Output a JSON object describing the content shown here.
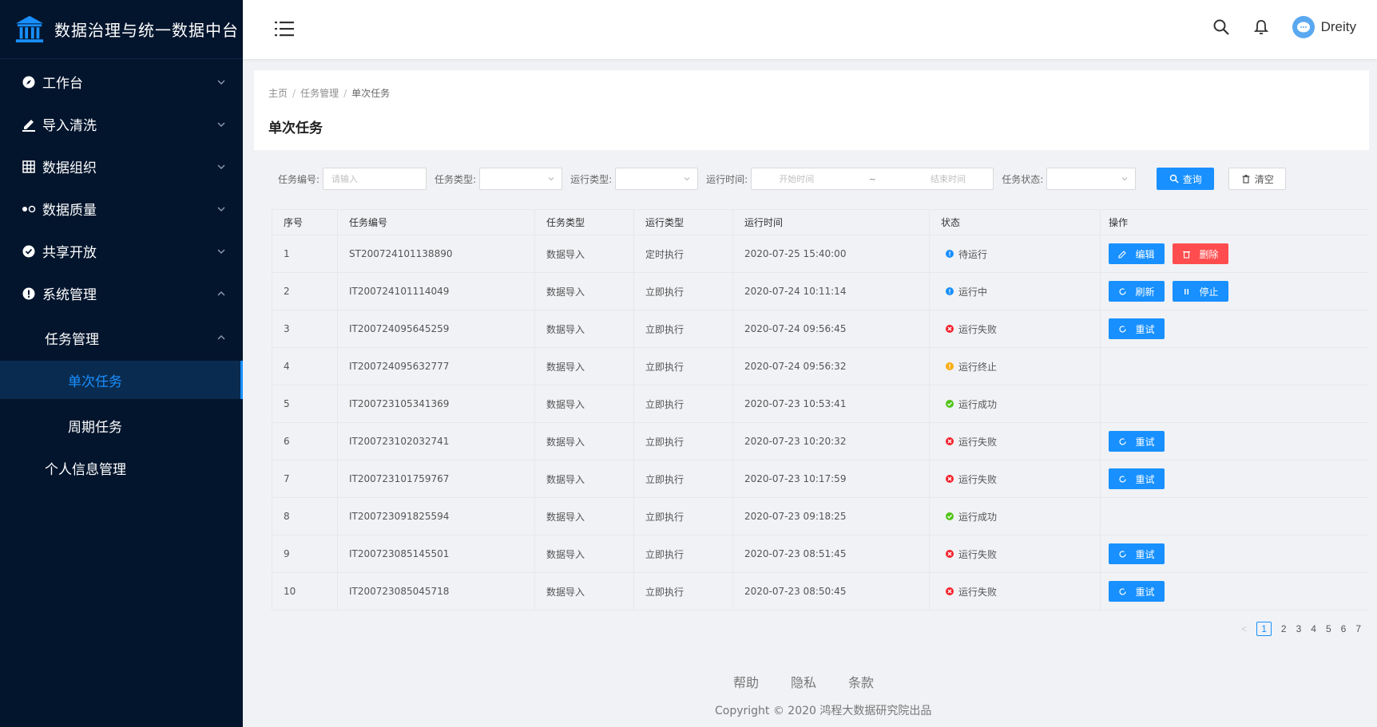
{
  "app": {
    "title": "数据治理与统一数据中台"
  },
  "sidebar": {
    "items": [
      {
        "label": "工作台",
        "icon": "compass-icon"
      },
      {
        "label": "导入清洗",
        "icon": "edit-icon"
      },
      {
        "label": "数据组织",
        "icon": "grid-icon"
      },
      {
        "label": "数据质量",
        "icon": "toggle-icon"
      },
      {
        "label": "共享开放",
        "icon": "check-circle-icon"
      },
      {
        "label": "系统管理",
        "icon": "alert-circle-icon"
      }
    ],
    "sub": {
      "label": "任务管理"
    },
    "subsub": [
      {
        "label": "单次任务"
      },
      {
        "label": "周期任务"
      }
    ],
    "personal": {
      "label": "个人信息管理"
    }
  },
  "header": {
    "username": "Dreity"
  },
  "breadcrumb": {
    "home": "主页",
    "parent": "任务管理",
    "current": "单次任务"
  },
  "page": {
    "title": "单次任务"
  },
  "filter": {
    "task_no_label": "任务编号:",
    "task_no_placeholder": "请输入",
    "task_type_label": "任务类型:",
    "run_type_label": "运行类型:",
    "run_time_label": "运行时间:",
    "start_placeholder": "开始时间",
    "range_sep": "~",
    "end_placeholder": "结束时间",
    "status_label": "任务状态:",
    "query_label": "查询",
    "clear_label": "清空"
  },
  "table": {
    "headers": [
      "序号",
      "任务编号",
      "任务类型",
      "运行类型",
      "运行时间",
      "状态",
      "操作"
    ],
    "rows": [
      {
        "no": "1",
        "id": "ST200724101138890",
        "type": "数据导入",
        "run": "定时执行",
        "time": "2020-07-25 15:40:00",
        "status": "待运行",
        "color": "#1890ff",
        "actions": [
          "编辑",
          "删除"
        ]
      },
      {
        "no": "2",
        "id": "IT200724101114049",
        "type": "数据导入",
        "run": "立即执行",
        "time": "2020-07-24 10:11:14",
        "status": "运行中",
        "color": "#1890ff",
        "actions": [
          "刷新",
          "停止"
        ]
      },
      {
        "no": "3",
        "id": "IT200724095645259",
        "type": "数据导入",
        "run": "立即执行",
        "time": "2020-07-24 09:56:45",
        "status": "运行失败",
        "color": "#f5222d",
        "actions": [
          "重试"
        ]
      },
      {
        "no": "4",
        "id": "IT200724095632777",
        "type": "数据导入",
        "run": "立即执行",
        "time": "2020-07-24 09:56:32",
        "status": "运行终止",
        "color": "#faad14",
        "actions": []
      },
      {
        "no": "5",
        "id": "IT200723105341369",
        "type": "数据导入",
        "run": "立即执行",
        "time": "2020-07-23 10:53:41",
        "status": "运行成功",
        "color": "#52c41a",
        "actions": []
      },
      {
        "no": "6",
        "id": "IT200723102032741",
        "type": "数据导入",
        "run": "立即执行",
        "time": "2020-07-23 10:20:32",
        "status": "运行失败",
        "color": "#f5222d",
        "actions": [
          "重试"
        ]
      },
      {
        "no": "7",
        "id": "IT200723101759767",
        "type": "数据导入",
        "run": "立即执行",
        "time": "2020-07-23 10:17:59",
        "status": "运行失败",
        "color": "#f5222d",
        "actions": [
          "重试"
        ]
      },
      {
        "no": "8",
        "id": "IT200723091825594",
        "type": "数据导入",
        "run": "立即执行",
        "time": "2020-07-23 09:18:25",
        "status": "运行成功",
        "color": "#52c41a",
        "actions": []
      },
      {
        "no": "9",
        "id": "IT200723085145501",
        "type": "数据导入",
        "run": "立即执行",
        "time": "2020-07-23 08:51:45",
        "status": "运行失败",
        "color": "#f5222d",
        "actions": [
          "重试"
        ]
      },
      {
        "no": "10",
        "id": "IT200723085045718",
        "type": "数据导入",
        "run": "立即执行",
        "time": "2020-07-23 08:50:45",
        "status": "运行失败",
        "color": "#f5222d",
        "actions": [
          "重试"
        ]
      }
    ]
  },
  "pagination": {
    "prev": "<",
    "pages": [
      "1",
      "2",
      "3",
      "4",
      "5",
      "6",
      "7"
    ],
    "current": "1"
  },
  "footer": {
    "links": [
      "帮助",
      "隐私",
      "条款"
    ],
    "copyright": "Copyright © 2020 鸿程大数据研究院出品"
  },
  "colors": {
    "sidebar_bg": "#03152d",
    "primary": "#1890ff",
    "danger": "#ff4d4f"
  }
}
